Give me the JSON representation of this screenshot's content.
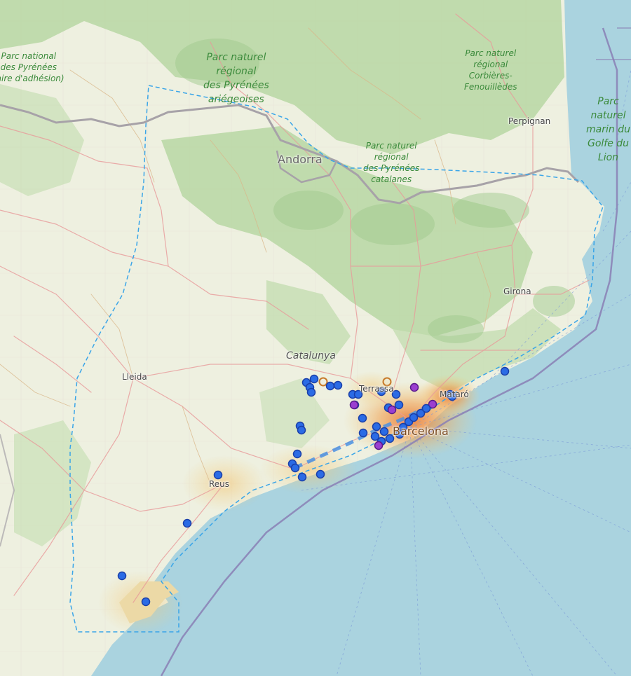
{
  "map": {
    "labels": {
      "park_pyrenees_national": "Parc national\ndes Pyrénées\n(aire d'adhésion)",
      "park_ariegeoises": "Parc naturel\nrégional\ndes Pyrénées\nariégeoises",
      "park_corbieres": "Parc naturel\nrégional\nCorbières-\nFenouillèdes",
      "park_catalanes": "Parc naturel\nrégional\ndes Pyrénées\ncatalanes",
      "park_marin": "Parc naturel\nmarin du\nGolfe du\nLion",
      "andorra": "Andorra",
      "perpignan": "Perpignan",
      "girona": "Girona",
      "catalunya": "Catalunya",
      "lleida": "Lleida",
      "terrassa": "Terrassa",
      "mataro": "Mataró",
      "barcelona": "Barcelona",
      "reus": "Reus"
    },
    "colors": {
      "sea": "#aad3df",
      "land": "#f2efe9",
      "forest": "#add19e",
      "urban": "#e8a05a",
      "marker_blue": "#2b6be5",
      "marker_purple": "#9b3fd0",
      "marker_orange": "#c77a2a",
      "boundary_dashed": "#3aa5e8",
      "route_dashed": "#4a90e2",
      "border": "#9e9e9e"
    },
    "markers": [
      {
        "type": "blue"
      },
      {
        "type": "blue"
      },
      {
        "type": "orange"
      },
      {
        "type": "blue"
      },
      {
        "type": "blue"
      },
      {
        "type": "blue"
      },
      {
        "type": "blue"
      },
      {
        "type": "blue"
      },
      {
        "type": "blue"
      },
      {
        "type": "blue"
      },
      {
        "type": "orange"
      },
      {
        "type": "purple"
      },
      {
        "type": "blue"
      },
      {
        "type": "blue"
      },
      {
        "type": "blue"
      },
      {
        "type": "purple"
      },
      {
        "type": "blue"
      },
      {
        "type": "blue"
      },
      {
        "type": "blue"
      },
      {
        "type": "blue"
      },
      {
        "type": "blue"
      },
      {
        "type": "blue"
      },
      {
        "type": "blue"
      },
      {
        "type": "blue"
      },
      {
        "type": "blue"
      },
      {
        "type": "blue"
      },
      {
        "type": "purple"
      },
      {
        "type": "blue"
      },
      {
        "type": "blue"
      },
      {
        "type": "blue"
      },
      {
        "type": "blue"
      },
      {
        "type": "blue"
      },
      {
        "type": "purple"
      },
      {
        "type": "purple"
      },
      {
        "type": "blue"
      },
      {
        "type": "blue"
      },
      {
        "type": "blue"
      },
      {
        "type": "blue"
      },
      {
        "type": "blue"
      },
      {
        "type": "blue"
      },
      {
        "type": "blue"
      },
      {
        "type": "blue"
      },
      {
        "type": "blue"
      },
      {
        "type": "blue"
      },
      {
        "type": "blue"
      },
      {
        "type": "blue"
      },
      {
        "type": "blue"
      }
    ]
  }
}
